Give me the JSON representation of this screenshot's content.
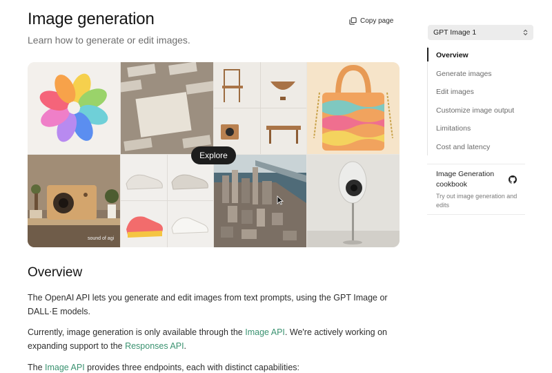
{
  "header": {
    "title": "Image generation",
    "subtitle": "Learn how to generate or edit images.",
    "copy_label": "Copy page",
    "copy_icon": "copy-icon"
  },
  "gallery": {
    "explore_label": "Explore",
    "watermark": "sound of agi",
    "tiles": [
      "flower-petals",
      "paper-cards",
      "wooden-furniture",
      "wavy-handbag",
      "speaker-shelf",
      "sneakers",
      "isometric-city",
      "standing-speaker"
    ]
  },
  "overview": {
    "title": "Overview",
    "p1": "The OpenAI API lets you generate and edit images from text prompts, using the GPT Image or DALL·E models.",
    "p2_before": "Currently, image generation is only available through the ",
    "p2_link1": "Image API",
    "p2_mid": ". We're actively working on expanding support to the ",
    "p2_link2": "Responses API",
    "p2_after": ".",
    "p3_before": "The ",
    "p3_link": "Image API",
    "p3_after": " provides three endpoints, each with distinct capabilities:"
  },
  "sidebar": {
    "model_select": "GPT Image 1",
    "toc": [
      {
        "label": "Overview",
        "active": true
      },
      {
        "label": "Generate images",
        "active": false
      },
      {
        "label": "Edit images",
        "active": false
      },
      {
        "label": "Customize image output",
        "active": false
      },
      {
        "label": "Limitations",
        "active": false
      },
      {
        "label": "Cost and latency",
        "active": false
      }
    ],
    "cookbook": {
      "title": "Image Generation cookbook",
      "description": "Try out image generation and edits",
      "icon": "github-icon"
    }
  },
  "colors": {
    "link": "#3a9270",
    "explore_bg": "#1d1d1d"
  }
}
